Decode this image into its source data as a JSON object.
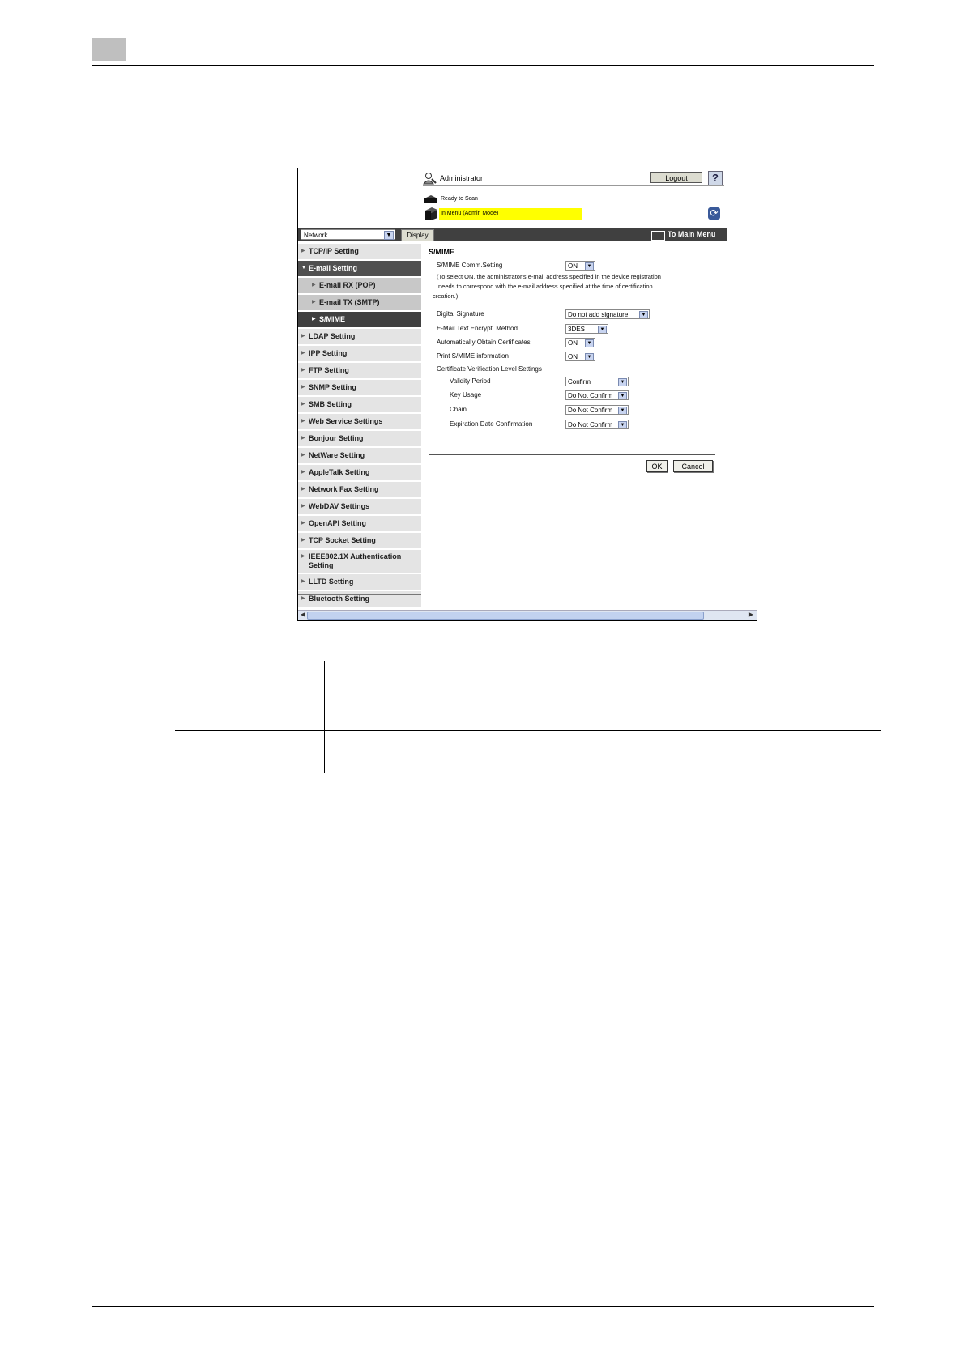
{
  "header": {
    "admin_label": "Administrator",
    "logout_label": "Logout",
    "help_label": "?",
    "status_ready": "Ready to Scan",
    "status_mode": "In Menu (Admin Mode)"
  },
  "navbar": {
    "mode_value": "Network",
    "display_label": "Display",
    "main_menu_label": "To Main Menu"
  },
  "sidebar": {
    "items": [
      {
        "label": "TCP/IP Setting",
        "state": "normal"
      },
      {
        "label": "E-mail Setting",
        "state": "expanded"
      },
      {
        "label": "E-mail RX (POP)",
        "state": "sub"
      },
      {
        "label": "E-mail TX (SMTP)",
        "state": "sub"
      },
      {
        "label": "S/MIME",
        "state": "selected"
      },
      {
        "label": "LDAP Setting",
        "state": "normal"
      },
      {
        "label": "IPP Setting",
        "state": "normal"
      },
      {
        "label": "FTP Setting",
        "state": "normal"
      },
      {
        "label": "SNMP Setting",
        "state": "normal"
      },
      {
        "label": "SMB Setting",
        "state": "normal"
      },
      {
        "label": "Web Service Settings",
        "state": "normal"
      },
      {
        "label": "Bonjour Setting",
        "state": "normal"
      },
      {
        "label": "NetWare Setting",
        "state": "normal"
      },
      {
        "label": "AppleTalk Setting",
        "state": "normal"
      },
      {
        "label": "Network Fax Setting",
        "state": "normal"
      },
      {
        "label": "WebDAV Settings",
        "state": "normal"
      },
      {
        "label": "OpenAPI Setting",
        "state": "normal"
      },
      {
        "label": "TCP Socket Setting",
        "state": "normal"
      },
      {
        "label": "IEEE802.1X Authentication Setting",
        "state": "normal"
      },
      {
        "label": "LLTD Setting",
        "state": "normal"
      },
      {
        "label": "Bluetooth Setting",
        "state": "normal"
      }
    ]
  },
  "form": {
    "title": "S/MIME",
    "comm_label": "S/MIME Comm.Setting",
    "comm_value": "ON",
    "note_line1": "(To select ON, the administrator's e-mail address specified in the device registration",
    "note_line2": "needs to correspond with the e-mail address specified at the time of certification",
    "note_line3": "creation.)",
    "signature_label": "Digital Signature",
    "signature_value": "Do not add signature",
    "encrypt_label": "E-Mail Text Encrypt. Method",
    "encrypt_value": "3DES",
    "auto_cert_label": "Automatically Obtain Certificates",
    "auto_cert_value": "ON",
    "print_label": "Print S/MIME information",
    "print_value": "ON",
    "verify_group_label": "Certificate Verification Level Settings",
    "validity_label": "Validity Period",
    "validity_value": "Confirm",
    "key_usage_label": "Key Usage",
    "key_usage_value": "Do Not Confirm",
    "chain_label": "Chain",
    "chain_value": "Do Not Confirm",
    "expiration_label": "Expiration Date Confirmation",
    "expiration_value": "Do Not Confirm",
    "ok_label": "OK",
    "cancel_label": "Cancel"
  },
  "icons": {
    "admin": "admin-user-icon",
    "help": "help-icon",
    "scanner": "scanner-icon",
    "printer": "printer-icon",
    "refresh": "refresh-icon",
    "main_menu": "main-menu-icon"
  },
  "colors": {
    "status_highlight": "#ffff00",
    "navbar": "#404040",
    "sidebar_item": "#e4e4e4"
  }
}
